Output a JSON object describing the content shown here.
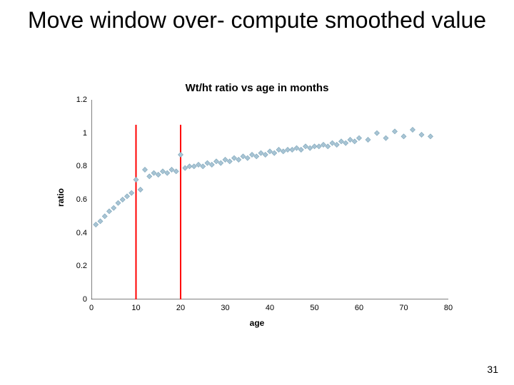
{
  "slide": {
    "title": "Move window over- compute smoothed value",
    "page_number": "31"
  },
  "chart_data": {
    "type": "scatter",
    "title": "Wt/ht ratio vs age in months",
    "xlabel": "age",
    "ylabel": "ratio",
    "xlim": [
      0,
      80
    ],
    "ylim": [
      0,
      1.2
    ],
    "xticks": [
      0,
      10,
      20,
      30,
      40,
      50,
      60,
      70,
      80
    ],
    "yticks": [
      0,
      0.2,
      0.4,
      0.6,
      0.8,
      1,
      1.2
    ],
    "window_lines_x": [
      10,
      20
    ],
    "series": [
      {
        "name": "wt_ht_ratio",
        "color": "#a8c4d4",
        "x": [
          1,
          2,
          3,
          4,
          5,
          6,
          7,
          8,
          9,
          10,
          11,
          12,
          13,
          14,
          15,
          16,
          17,
          18,
          19,
          20,
          21,
          22,
          23,
          24,
          25,
          26,
          27,
          28,
          29,
          30,
          31,
          32,
          33,
          34,
          35,
          36,
          37,
          38,
          39,
          40,
          41,
          42,
          43,
          44,
          45,
          46,
          47,
          48,
          49,
          50,
          51,
          52,
          53,
          54,
          55,
          56,
          57,
          58,
          59,
          60,
          62,
          64,
          66,
          68,
          70,
          72,
          74,
          76
        ],
        "y": [
          0.45,
          0.47,
          0.5,
          0.53,
          0.55,
          0.58,
          0.6,
          0.62,
          0.64,
          0.72,
          0.66,
          0.78,
          0.74,
          0.76,
          0.75,
          0.77,
          0.76,
          0.78,
          0.77,
          0.87,
          0.79,
          0.8,
          0.8,
          0.81,
          0.8,
          0.82,
          0.81,
          0.83,
          0.82,
          0.84,
          0.83,
          0.85,
          0.84,
          0.86,
          0.85,
          0.87,
          0.86,
          0.88,
          0.87,
          0.89,
          0.88,
          0.9,
          0.89,
          0.9,
          0.9,
          0.91,
          0.9,
          0.92,
          0.91,
          0.92,
          0.92,
          0.93,
          0.92,
          0.94,
          0.93,
          0.95,
          0.94,
          0.96,
          0.95,
          0.97,
          0.96,
          1.0,
          0.97,
          1.01,
          0.98,
          1.02,
          0.99,
          0.98
        ]
      }
    ]
  }
}
